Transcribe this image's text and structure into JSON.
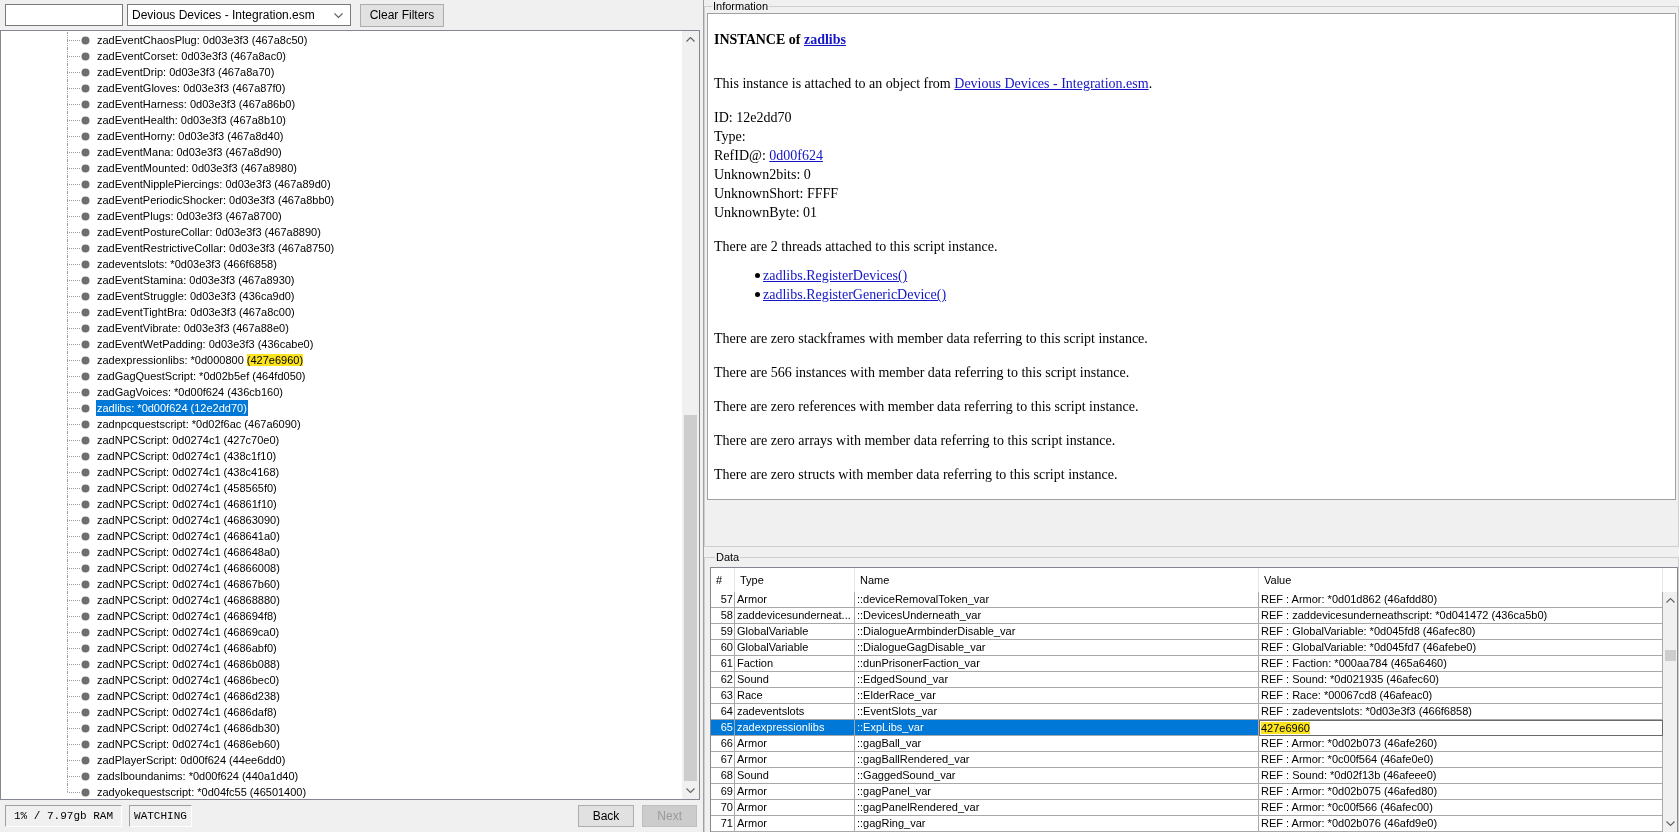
{
  "toolbar": {
    "plugin_filter": "Devious Devices - Integration.esm",
    "clear_button": "Clear Filters"
  },
  "tree": {
    "items": [
      {
        "label": "zadEventChaosPlug: 0d03e3f3 (467a8c50)",
        "selected": false
      },
      {
        "label": "zadEventCorset: 0d03e3f3 (467a8ac0)",
        "selected": false
      },
      {
        "label": "zadEventDrip: 0d03e3f3 (467a8a70)",
        "selected": false
      },
      {
        "label": "zadEventGloves: 0d03e3f3 (467a87f0)",
        "selected": false
      },
      {
        "label": "zadEventHarness: 0d03e3f3 (467a86b0)",
        "selected": false
      },
      {
        "label": "zadEventHealth: 0d03e3f3 (467a8b10)",
        "selected": false
      },
      {
        "label": "zadEventHorny: 0d03e3f3 (467a8d40)",
        "selected": false
      },
      {
        "label": "zadEventMana: 0d03e3f3 (467a8d90)",
        "selected": false
      },
      {
        "label": "zadEventMounted: 0d03e3f3 (467a8980)",
        "selected": false
      },
      {
        "label": "zadEventNipplePiercings: 0d03e3f3 (467a89d0)",
        "selected": false
      },
      {
        "label": "zadEventPeriodicShocker: 0d03e3f3 (467a8bb0)",
        "selected": false
      },
      {
        "label": "zadEventPlugs: 0d03e3f3 (467a8700)",
        "selected": false
      },
      {
        "label": "zadEventPostureCollar: 0d03e3f3 (467a8890)",
        "selected": false
      },
      {
        "label": "zadEventRestrictiveCollar: 0d03e3f3 (467a8750)",
        "selected": false
      },
      {
        "label": "zadeventslots: *0d03e3f3 (466f6858)",
        "selected": false
      },
      {
        "label": "zadEventStamina: 0d03e3f3 (467a8930)",
        "selected": false
      },
      {
        "label": "zadEventStruggle: 0d03e3f3 (436ca9d0)",
        "selected": false
      },
      {
        "label": "zadEventTightBra: 0d03e3f3 (467a8c00)",
        "selected": false
      },
      {
        "label": "zadEventVibrate: 0d03e3f3 (467a88e0)",
        "selected": false
      },
      {
        "label": "zadEventWetPadding: 0d03e3f3 (436cabe0)",
        "selected": false
      },
      {
        "label": "zadexpressionlibs: *0d000800",
        "highlight": "(427e6960)",
        "selected": false
      },
      {
        "label": "zadGagQuestScript: *0d02b5ef (464fd050)",
        "selected": false
      },
      {
        "label": "zadGagVoices: *0d00f624 (436cb160)",
        "selected": false
      },
      {
        "label": "zadlibs: *0d00f624 (12e2dd70)",
        "selected": true
      },
      {
        "label": "zadnpcquestscript: *0d02f6ac (467a6090)",
        "selected": false
      },
      {
        "label": "zadNPCScript: 0d0274c1 (427c70e0)",
        "selected": false
      },
      {
        "label": "zadNPCScript: 0d0274c1 (438c1f10)",
        "selected": false
      },
      {
        "label": "zadNPCScript: 0d0274c1 (438c4168)",
        "selected": false
      },
      {
        "label": "zadNPCScript: 0d0274c1 (458565f0)",
        "selected": false
      },
      {
        "label": "zadNPCScript: 0d0274c1 (46861f10)",
        "selected": false
      },
      {
        "label": "zadNPCScript: 0d0274c1 (46863090)",
        "selected": false
      },
      {
        "label": "zadNPCScript: 0d0274c1 (468641a0)",
        "selected": false
      },
      {
        "label": "zadNPCScript: 0d0274c1 (468648a0)",
        "selected": false
      },
      {
        "label": "zadNPCScript: 0d0274c1 (46866008)",
        "selected": false
      },
      {
        "label": "zadNPCScript: 0d0274c1 (46867b60)",
        "selected": false
      },
      {
        "label": "zadNPCScript: 0d0274c1 (46868880)",
        "selected": false
      },
      {
        "label": "zadNPCScript: 0d0274c1 (468694f8)",
        "selected": false
      },
      {
        "label": "zadNPCScript: 0d0274c1 (46869ca0)",
        "selected": false
      },
      {
        "label": "zadNPCScript: 0d0274c1 (4686abf0)",
        "selected": false
      },
      {
        "label": "zadNPCScript: 0d0274c1 (4686b088)",
        "selected": false
      },
      {
        "label": "zadNPCScript: 0d0274c1 (4686bec0)",
        "selected": false
      },
      {
        "label": "zadNPCScript: 0d0274c1 (4686d238)",
        "selected": false
      },
      {
        "label": "zadNPCScript: 0d0274c1 (4686daf8)",
        "selected": false
      },
      {
        "label": "zadNPCScript: 0d0274c1 (4686db30)",
        "selected": false
      },
      {
        "label": "zadNPCScript: 0d0274c1 (4686eb60)",
        "selected": false
      },
      {
        "label": "zadPlayerScript: 0d00f624 (44ee6dd0)",
        "selected": false
      },
      {
        "label": "zadslboundanims: *0d00f624 (440a1d40)",
        "selected": false
      },
      {
        "label": "zadyokequestscript: *0d04fc55 (46501400)",
        "selected": false
      }
    ]
  },
  "status_bar": {
    "memory": "1% / 7.97gb RAM",
    "mode": "WATCHING"
  },
  "navigation": [
    {
      "label": "Back",
      "disabled": false
    },
    {
      "label": "Next",
      "disabled": true
    }
  ],
  "information": {
    "title": "Information",
    "heading": {
      "prefix": "INSTANCE of",
      "link": "zadlibs"
    },
    "source": {
      "text": "This instance is attached to an object from",
      "link": "Devious Devices - Integration.esm",
      "suffix": "."
    },
    "fields": [
      {
        "kind": "text",
        "label": "ID:",
        "value": "12e2dd70"
      },
      {
        "kind": "text",
        "label": "Type:"
      },
      {
        "kind": "link",
        "label": "RefID@:",
        "value": "0d00f624"
      },
      {
        "kind": "text",
        "label": "Unknown2bits:",
        "value": "0"
      },
      {
        "kind": "text",
        "label": "UnknownShort:",
        "value": "FFFF"
      },
      {
        "kind": "text",
        "label": "UnknownByte:",
        "value": "01"
      }
    ],
    "threads_intro": "There are 2 threads attached to this script instance.",
    "threads": [
      "zadlibs.RegisterDevices()",
      "zadlibs.RegisterGenericDevice()"
    ],
    "summaries": [
      "There are zero stackframes with member data referring to this script instance.",
      "There are 566 instances with member data referring to this script instance.",
      "There are zero references with member data referring to this script instance.",
      "There are zero arrays with member data referring to this script instance.",
      "There are zero structs with member data referring to this script instance."
    ]
  },
  "data": {
    "title": "Data",
    "columns": [
      "#",
      "Type",
      "Name",
      "Value"
    ],
    "rows": [
      {
        "index": "57",
        "type": "Armor",
        "name": "::deviceRemovalToken_var",
        "value": "REF : Armor: *0d01d862 (46afdd80)",
        "selected": false,
        "highlighted": false
      },
      {
        "index": "58",
        "type": "zaddevicesunderneat...",
        "name": "::DevicesUnderneath_var",
        "value": "REF : zaddevicesunderneathscript: *0d041472 (436ca5b0)",
        "selected": false,
        "highlighted": false
      },
      {
        "index": "59",
        "type": "GlobalVariable",
        "name": "::DialogueArmbinderDisable_var",
        "value": "REF : GlobalVariable: *0d045fd8 (46afec80)",
        "selected": false,
        "highlighted": false
      },
      {
        "index": "60",
        "type": "GlobalVariable",
        "name": "::DialogueGagDisable_var",
        "value": "REF : GlobalVariable: *0d045fd7 (46afebe0)",
        "selected": false,
        "highlighted": false
      },
      {
        "index": "61",
        "type": "Faction",
        "name": "::dunPrisonerFaction_var",
        "value": "REF : Faction: *000aa784 (465a6460)",
        "selected": false,
        "highlighted": false
      },
      {
        "index": "62",
        "type": "Sound",
        "name": "::EdgedSound_var",
        "value": "REF : Sound: *0d021935 (46afec60)",
        "selected": false,
        "highlighted": false
      },
      {
        "index": "63",
        "type": "Race",
        "name": "::ElderRace_var",
        "value": "REF : Race: *00067cd8 (46afeac0)",
        "selected": false,
        "highlighted": false
      },
      {
        "index": "64",
        "type": "zadeventslots",
        "name": "::EventSlots_var",
        "value": "REF : zadeventslots: *0d03e3f3 (466f6858)",
        "selected": false,
        "highlighted": false
      },
      {
        "index": "65",
        "type": "zadexpressionlibs",
        "name": "::ExpLibs_var",
        "value": "427e6960",
        "selected": true,
        "highlighted": true
      },
      {
        "index": "66",
        "type": "Armor",
        "name": "::gagBall_var",
        "value": "REF : Armor: *0d02b073 (46afe260)",
        "selected": false,
        "highlighted": false
      },
      {
        "index": "67",
        "type": "Armor",
        "name": "::gagBallRendered_var",
        "value": "REF : Armor: *0c00f564 (46afe0e0)",
        "selected": false,
        "highlighted": false
      },
      {
        "index": "68",
        "type": "Sound",
        "name": "::GaggedSound_var",
        "value": "REF : Sound: *0d02f13b (46afeee0)",
        "selected": false,
        "highlighted": false
      },
      {
        "index": "69",
        "type": "Armor",
        "name": "::gagPanel_var",
        "value": "REF : Armor: *0d02b075 (46afed80)",
        "selected": false,
        "highlighted": false
      },
      {
        "index": "70",
        "type": "Armor",
        "name": "::gagPanelRendered_var",
        "value": "REF : Armor: *0c00f566 (46afec00)",
        "selected": false,
        "highlighted": false
      },
      {
        "index": "71",
        "type": "Armor",
        "name": "::gagRing_var",
        "value": "REF : Armor: *0d02b076 (46afd9e0)",
        "selected": false,
        "highlighted": false
      }
    ]
  }
}
